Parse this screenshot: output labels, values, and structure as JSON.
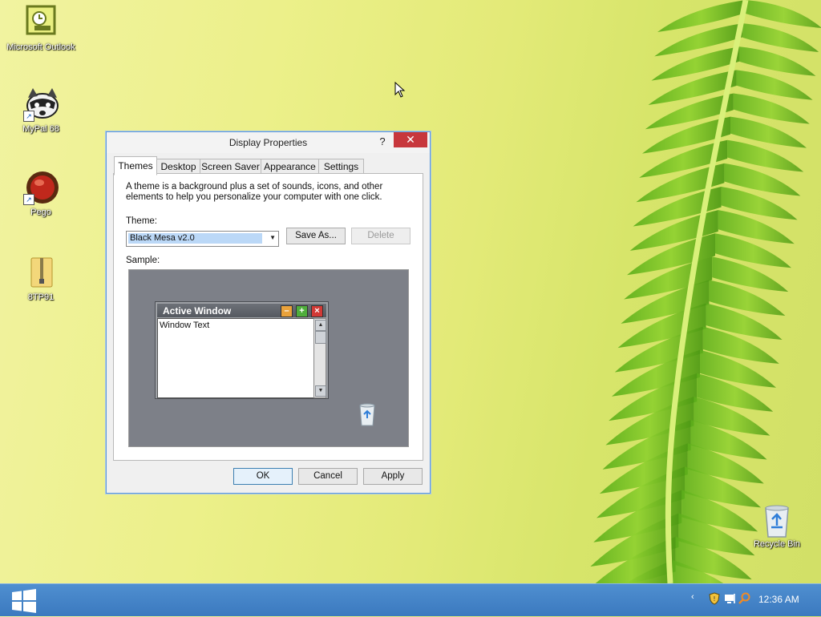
{
  "desktop": {
    "icons": [
      {
        "label": "Microsoft Outlook",
        "icon": "outlook-icon"
      },
      {
        "label": "MyPal 68",
        "icon": "raccoon-icon"
      },
      {
        "label": "Pego",
        "icon": "red-ball-icon"
      },
      {
        "label": "8TP91",
        "icon": "zip-folder-icon"
      },
      {
        "label": "Recycle Bin",
        "icon": "recycle-bin-icon"
      }
    ]
  },
  "dialog": {
    "title": "Display Properties",
    "help_label": "?",
    "close_label": "✕",
    "tabs": [
      {
        "label": "Themes",
        "active": true
      },
      {
        "label": "Desktop",
        "active": false
      },
      {
        "label": "Screen Saver",
        "active": false
      },
      {
        "label": "Appearance",
        "active": false
      },
      {
        "label": "Settings",
        "active": false
      }
    ],
    "description": "A theme is a background plus a set of sounds, icons, and other elements to help you personalize your computer with one click.",
    "theme_label": "Theme:",
    "theme_value": "Black Mesa v2.0",
    "save_as_label": "Save As...",
    "delete_label": "Delete",
    "sample_label": "Sample:",
    "sample": {
      "window_title": "Active Window",
      "window_text": "Window Text"
    },
    "ok_label": "OK",
    "cancel_label": "Cancel",
    "apply_label": "Apply"
  },
  "taskbar": {
    "clock": "12:36 AM",
    "tray_icons": [
      "chevron-icon",
      "shield-icon",
      "network-icon",
      "search-icon"
    ]
  },
  "colors": {
    "taskbar": "#3f7dc4",
    "close_button": "#c7373c",
    "dialog_border": "#5f9ad6"
  }
}
